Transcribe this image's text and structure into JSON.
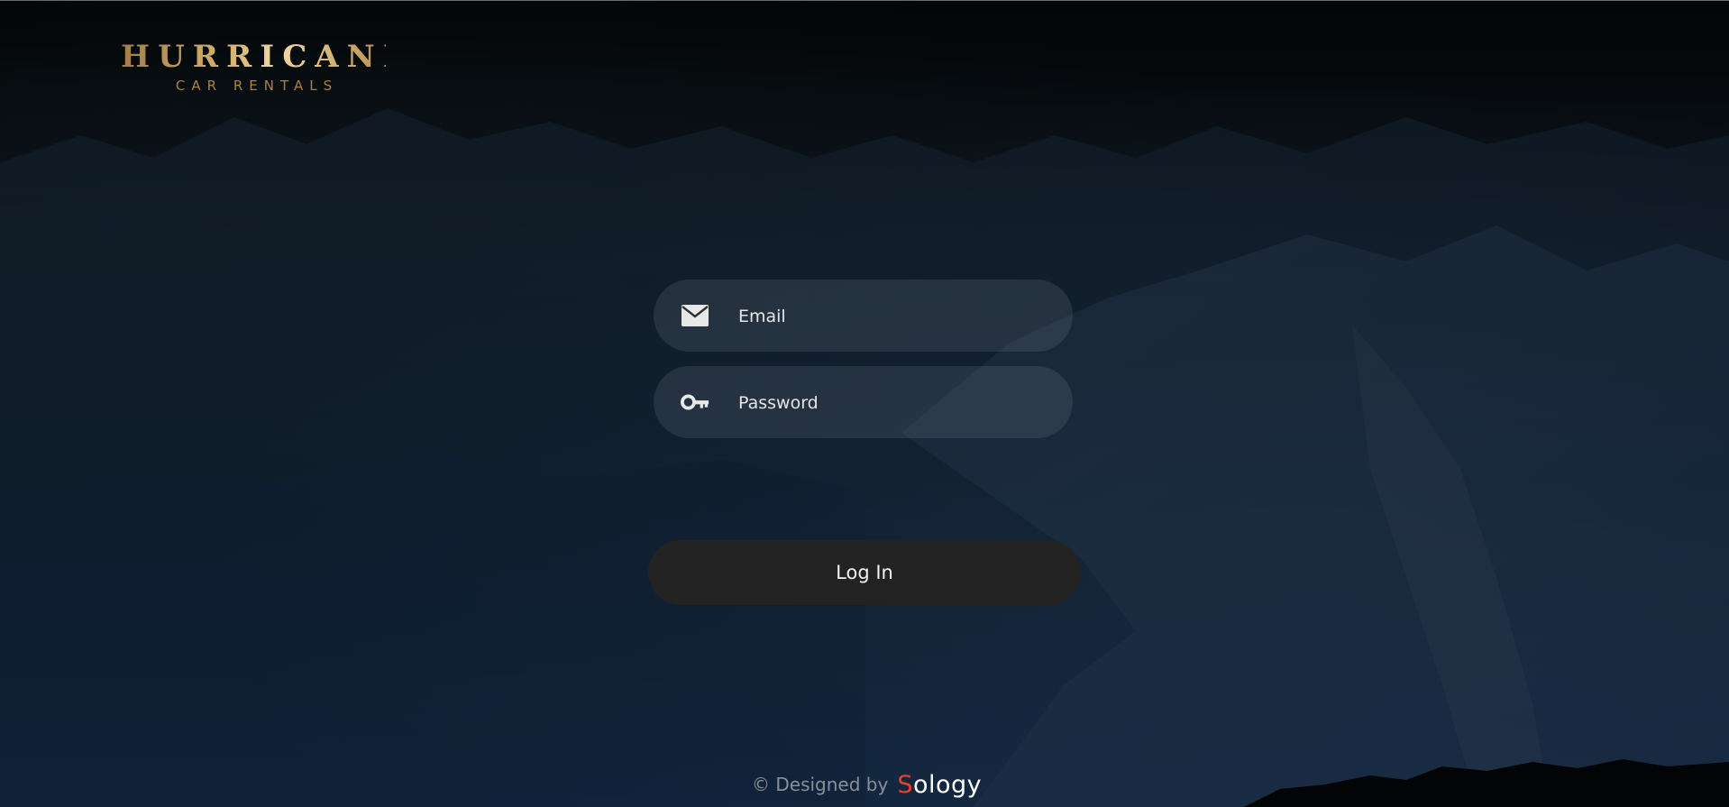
{
  "logo": {
    "title": "HURRICANE",
    "subtitle": "CAR RENTALS"
  },
  "form": {
    "email": {
      "placeholder": "Email",
      "value": "",
      "icon": "mail-icon"
    },
    "password": {
      "placeholder": "Password",
      "value": "",
      "icon": "key-icon"
    },
    "login_label": "Log In"
  },
  "footer": {
    "text": "© Designed by",
    "brand_first": "S",
    "brand_rest": "ology"
  },
  "colors": {
    "logo_gold": "#d9b877",
    "button_bg": "#232323",
    "field_bg": "rgba(120,130,145,0.20)",
    "brand_accent": "#e8402c"
  }
}
